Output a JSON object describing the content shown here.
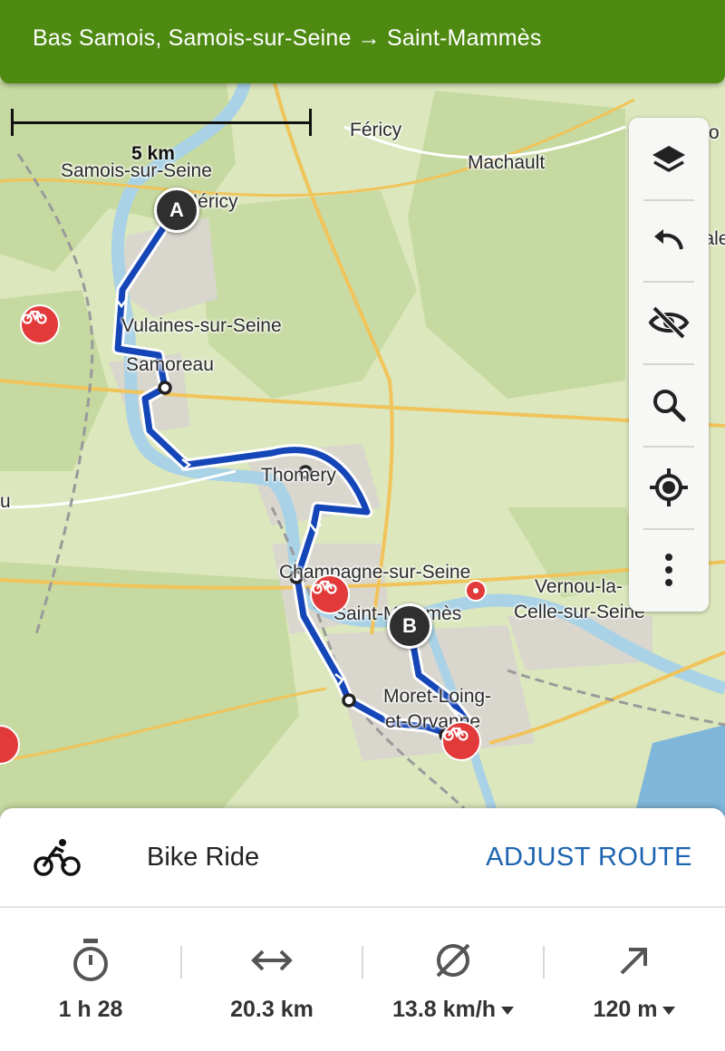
{
  "header": {
    "title": "Bas Samois, Samois-sur-Seine → Saint-Mammès"
  },
  "map": {
    "scale_label": "5 km",
    "places": [
      {
        "id": "fericy",
        "label": "Féricy"
      },
      {
        "id": "pamfou",
        "label": "Pamfo"
      },
      {
        "id": "machault",
        "label": "Machault"
      },
      {
        "id": "samois",
        "label": "Samois-sur-Seine"
      },
      {
        "id": "hericy",
        "label": "Héricy"
      },
      {
        "id": "vale",
        "label": "Vale"
      },
      {
        "id": "vulaines",
        "label": "Vulaines-sur-Seine"
      },
      {
        "id": "samoreau",
        "label": "Samoreau"
      },
      {
        "id": "thomery",
        "label": "Thomery"
      },
      {
        "id": "u",
        "label": "u"
      },
      {
        "id": "champagne",
        "label": "Champagne-sur-Seine"
      },
      {
        "id": "vernou",
        "label": "Vernou-la-"
      },
      {
        "id": "celle",
        "label": "Celle-sur-Seine"
      },
      {
        "id": "saintmammes",
        "label": "Saint-Mammès"
      },
      {
        "id": "moret1",
        "label": "Moret-Loing-"
      },
      {
        "id": "moret2",
        "label": "et-Orvanne"
      }
    ],
    "start_marker": "A",
    "end_marker": "B"
  },
  "toolbar": {
    "items": [
      {
        "name": "layers",
        "icon": "layers-icon"
      },
      {
        "name": "undo",
        "icon": "undo-icon"
      },
      {
        "name": "hide",
        "icon": "eye-off-icon"
      },
      {
        "name": "search",
        "icon": "search-icon"
      },
      {
        "name": "locate",
        "icon": "locate-icon"
      },
      {
        "name": "more",
        "icon": "more-vertical-icon"
      }
    ]
  },
  "route": {
    "activity_icon": "bike-icon",
    "activity": "Bike Ride",
    "adjust_label": "ADJUST ROUTE",
    "accent_color": "#1d64b0",
    "route_color": "#1546b8"
  },
  "stats": {
    "duration": "1 h 28",
    "distance": "20.3 km",
    "speed": "13.8 km/h",
    "elevation": "120 m"
  }
}
